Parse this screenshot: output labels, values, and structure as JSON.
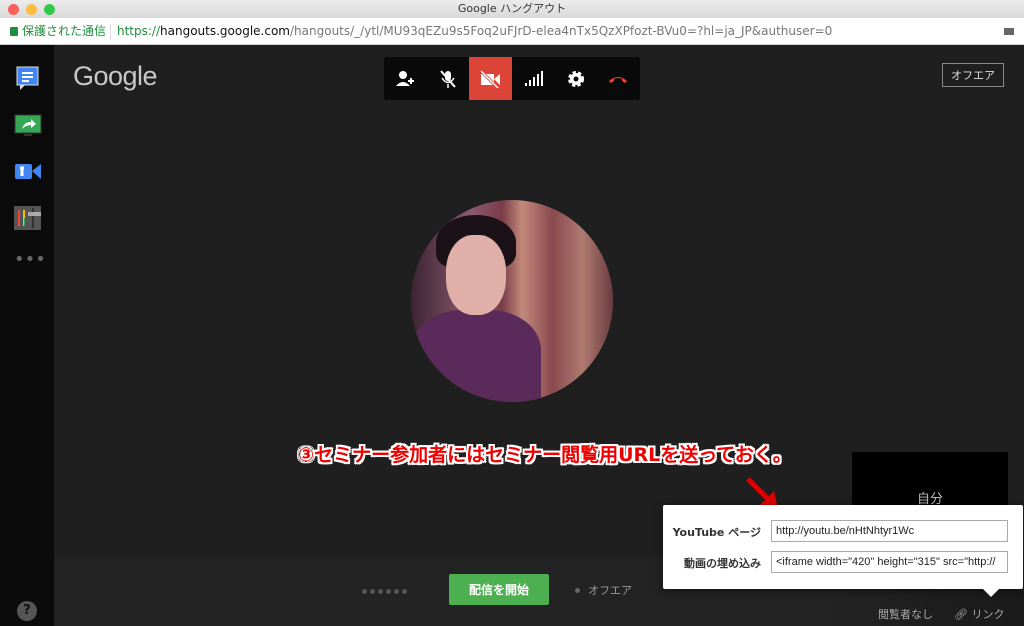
{
  "window": {
    "title": "Google ハングアウト"
  },
  "addressbar": {
    "security_label": "保護された通信",
    "url_scheme": "https://",
    "url_host": "hangouts.google.com",
    "url_path": "/hangouts/_/ytl/MU93qEZu9s5Foq2uFJrD-elea4nTx5QzXPfozt-BVu0=?hl=ja_JP&authuser=0"
  },
  "sidebar": {
    "items": [
      {
        "icon": "chat-icon"
      },
      {
        "icon": "screenshare-icon"
      },
      {
        "icon": "camera-settings-icon"
      },
      {
        "icon": "control-room-icon"
      },
      {
        "icon": "more-icon"
      }
    ],
    "help": "?"
  },
  "logo": "Google",
  "toolbar": {
    "buttons": [
      {
        "icon": "add-person-icon"
      },
      {
        "icon": "mic-off-icon"
      },
      {
        "icon": "camera-off-icon",
        "active": true
      },
      {
        "icon": "signal-icon"
      },
      {
        "icon": "gear-icon"
      },
      {
        "icon": "hang-up-icon"
      }
    ],
    "accent": "#db4437"
  },
  "status_badge": "オフエア",
  "annotation": "③セミナー参加者にはセミナー閲覧用URLを送っておく。",
  "self_tile": "自分",
  "bottom": {
    "start_button": "配信を開始",
    "status": "オフエア",
    "viewers": "閲覧者なし",
    "link": "リンク",
    "start_color": "#4caf50"
  },
  "popup": {
    "youtube_label": "YouTube ページ",
    "youtube_value": "http://youtu.be/nHtNhtyr1Wc",
    "embed_label": "動画の埋め込み",
    "embed_value": "<iframe width=\"420\" height=\"315\" src=\"http://"
  }
}
